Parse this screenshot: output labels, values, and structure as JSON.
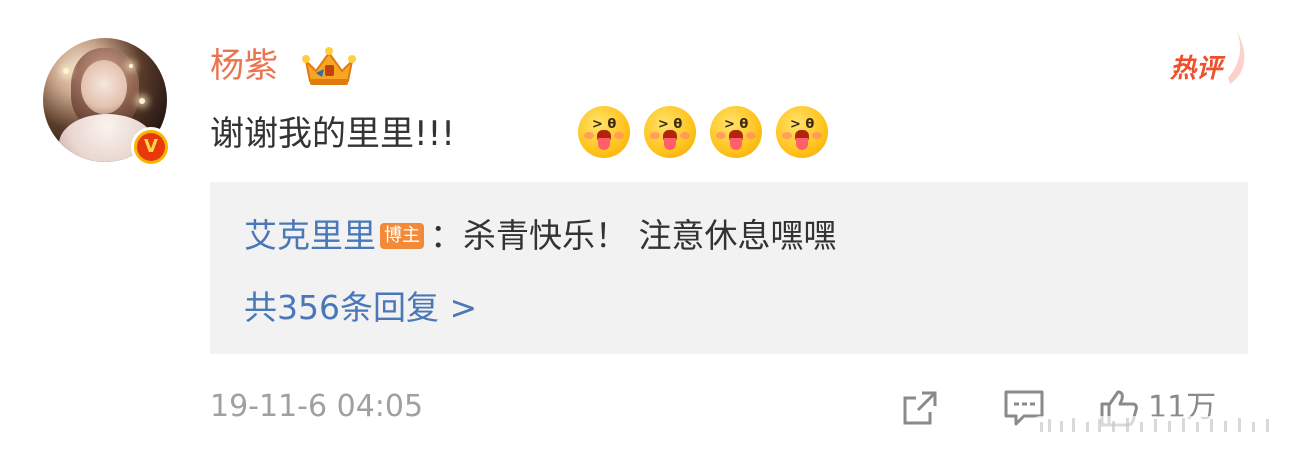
{
  "comment": {
    "username": "杨紫",
    "text": "谢谢我的里里!!!",
    "hot_tag": "热评",
    "verified_badge": "V",
    "emoji_eye": "> θ",
    "emoji_count": 4,
    "timestamp": "19-11-6 04:05",
    "likes": "11万"
  },
  "reply": {
    "author": "艾克里里",
    "author_tag": "博主",
    "text": "：杀青快乐！ 注意休息嘿嘿",
    "count_label": "共356条回复 >"
  },
  "icons": {
    "crown": "crown-icon",
    "forward": "share-icon",
    "comment": "comment-icon",
    "like": "thumb-up-icon"
  },
  "colors": {
    "username": "#eb7350",
    "link": "#4a77b8",
    "hot": "#f04f2e",
    "muted": "#a0a0a0",
    "reply_bg": "#f2f2f2"
  }
}
